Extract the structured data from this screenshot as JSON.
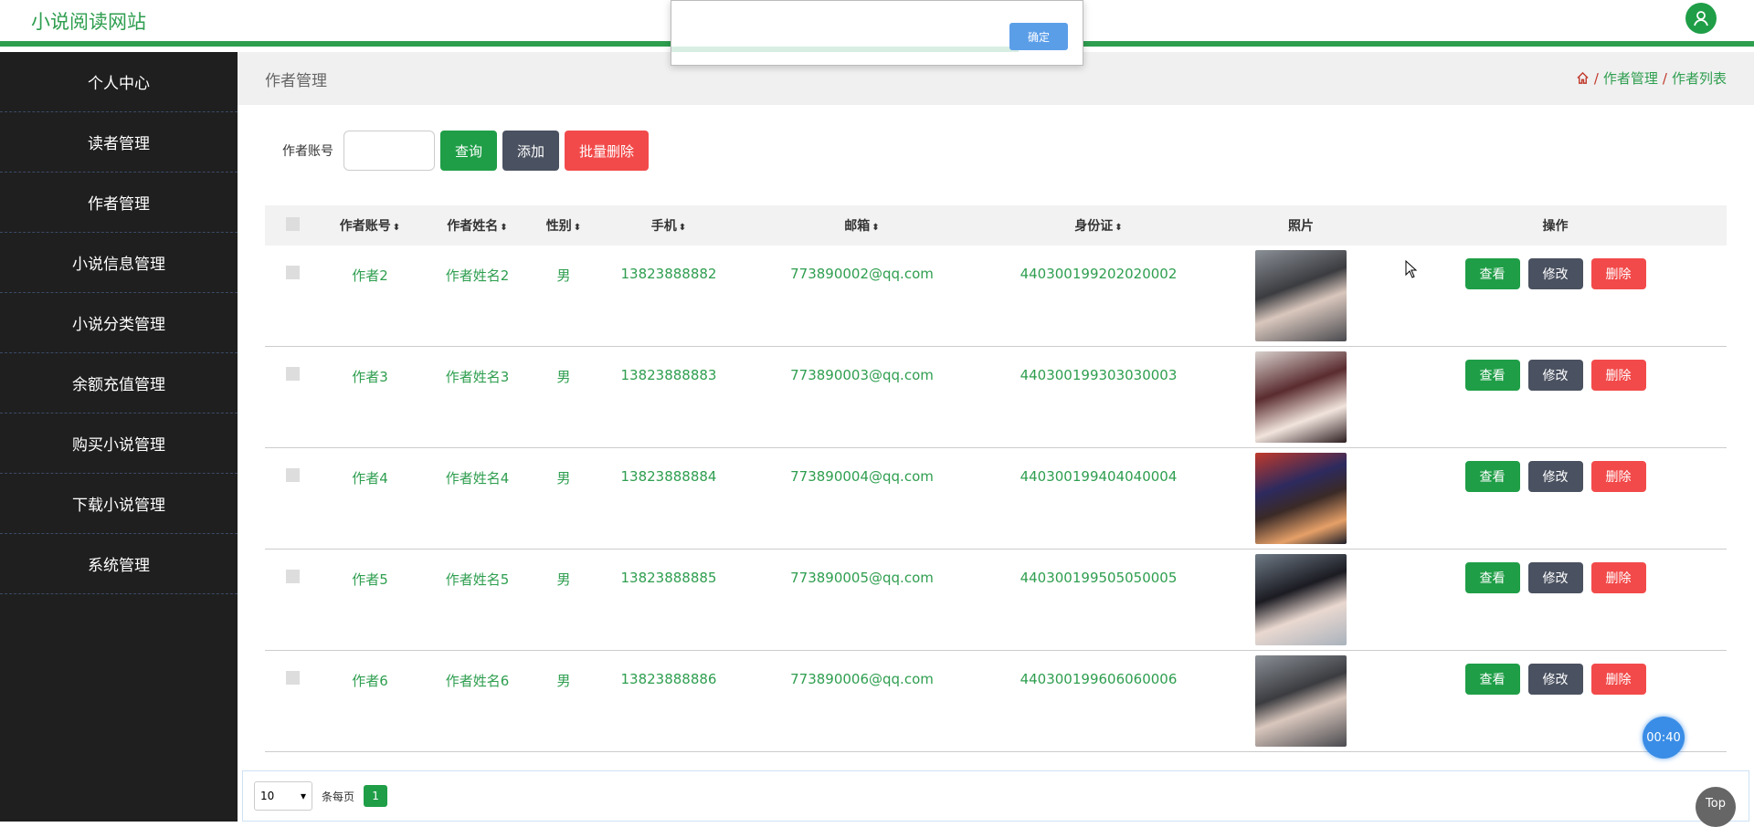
{
  "header": {
    "site_title": "小说阅读网站",
    "user_icon": "user-icon"
  },
  "sidebar": {
    "items": [
      {
        "label": "个人中心"
      },
      {
        "label": "读者管理"
      },
      {
        "label": "作者管理"
      },
      {
        "label": "小说信息管理"
      },
      {
        "label": "小说分类管理"
      },
      {
        "label": "余额充值管理"
      },
      {
        "label": "购买小说管理"
      },
      {
        "label": "下载小说管理"
      },
      {
        "label": "系统管理"
      }
    ]
  },
  "page": {
    "title": "作者管理",
    "breadcrumb": [
      "作者管理",
      "作者列表"
    ],
    "home_icon": "home-icon"
  },
  "search": {
    "label": "作者账号",
    "value": "",
    "query_btn": "查询",
    "add_btn": "添加",
    "batch_delete_btn": "批量删除"
  },
  "table": {
    "columns": [
      "作者账号",
      "作者姓名",
      "性别",
      "手机",
      "邮箱",
      "身份证",
      "照片",
      "操作"
    ],
    "rows": [
      {
        "account": "作者2",
        "name": "作者姓名2",
        "gender": "男",
        "phone": "13823888882",
        "email": "773890002@qq.com",
        "id_card": "440300199202020002"
      },
      {
        "account": "作者3",
        "name": "作者姓名3",
        "gender": "男",
        "phone": "13823888883",
        "email": "773890003@qq.com",
        "id_card": "440300199303030003"
      },
      {
        "account": "作者4",
        "name": "作者姓名4",
        "gender": "男",
        "phone": "13823888884",
        "email": "773890004@qq.com",
        "id_card": "440300199404040004"
      },
      {
        "account": "作者5",
        "name": "作者姓名5",
        "gender": "男",
        "phone": "13823888885",
        "email": "773890005@qq.com",
        "id_card": "440300199505050005"
      },
      {
        "account": "作者6",
        "name": "作者姓名6",
        "gender": "男",
        "phone": "13823888886",
        "email": "773890006@qq.com",
        "id_card": "440300199606060006"
      }
    ],
    "actions": {
      "view": "查看",
      "edit": "修改",
      "delete": "删除"
    }
  },
  "pagination": {
    "page_size": "10",
    "per_page_label": "条每页",
    "current_page": "1"
  },
  "dialog": {
    "ok_label": "确定"
  },
  "timer": {
    "text": "00:40"
  },
  "back_to_top": {
    "label": "Top"
  },
  "colors": {
    "accent": "#2e9e4f",
    "sidebar_bg": "#1f1f1f",
    "danger": "#f24a4a",
    "dark_btn": "#4a5160"
  }
}
